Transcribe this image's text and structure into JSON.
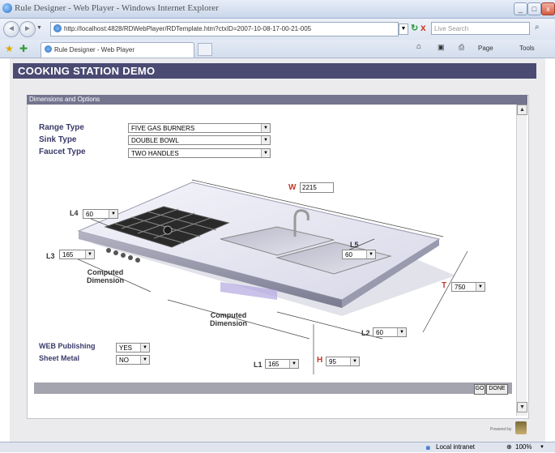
{
  "window": {
    "title": "Rule Designer - Web Player - Windows Internet Explorer",
    "minimize": "_",
    "maximize": "□",
    "close": "x"
  },
  "browser": {
    "back": "◄",
    "forward": "►",
    "url": "http://localhost:4828/RDWebPlayer/RDTemplate.htm?ctxID=2007-10-08-17-00-21-005",
    "refresh": "↻",
    "stop": "x",
    "search_placeholder": "Live Search",
    "tab_label": "Rule Designer - Web Player",
    "page_menu": "Page",
    "tools_menu": "Tools"
  },
  "app": {
    "banner_title": "COOKING STATION DEMO",
    "panel_title": "Dimensions and Options"
  },
  "options": {
    "range_type_label": "Range Type",
    "range_type_value": "FIVE GAS BURNERS",
    "sink_type_label": "Sink Type",
    "sink_type_value": "DOUBLE BOWL",
    "faucet_type_label": "Faucet Type",
    "faucet_type_value": "TWO HANDLES"
  },
  "dimensions": {
    "w_label": "W",
    "w_value": "2215",
    "l4_label": "L4",
    "l4_value": "60",
    "l3_label": "L3",
    "l3_value": "165",
    "l5_label": "L5",
    "l5_value": "60",
    "t_label": "T",
    "t_value": "750",
    "l2_label": "L2",
    "l2_value": "60",
    "l1_label": "L1",
    "l1_value": "165",
    "h_label": "H",
    "h_value": "95",
    "computed_1": "Computed Dimension",
    "computed_2": "Computed Dimension"
  },
  "publishing": {
    "web_label": "WEB Publishing",
    "web_value": "YES",
    "sheet_label": "Sheet Metal",
    "sheet_value": "NO"
  },
  "actions": {
    "go": "GO",
    "done": "DONE"
  },
  "footer": {
    "powered_by": "Powered by"
  },
  "statusbar": {
    "zone": "Local intranet",
    "zoom": "100%"
  }
}
